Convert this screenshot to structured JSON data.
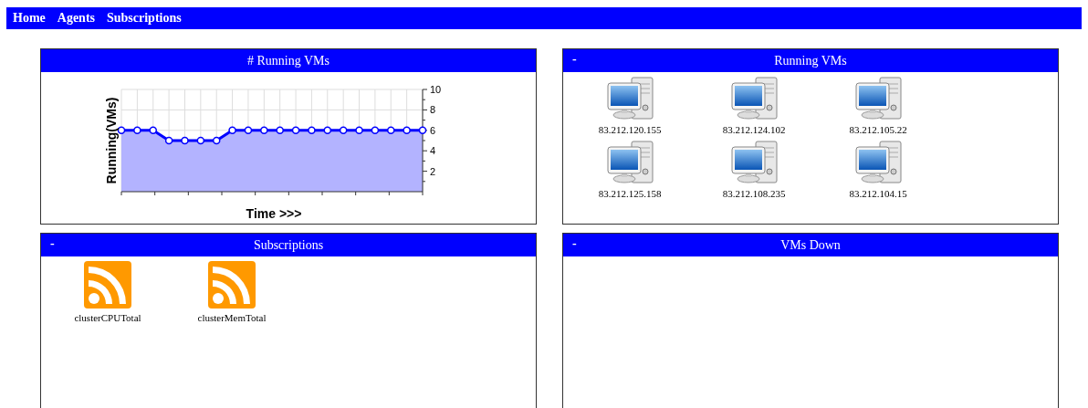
{
  "nav": [
    {
      "label": "Home"
    },
    {
      "label": "Agents"
    },
    {
      "label": "Subscriptions"
    }
  ],
  "panels": [
    {
      "kind": "chart",
      "title": "# Running VMs",
      "chart_data": {
        "type": "area",
        "xlabel": "Time >>>",
        "ylabel": "Running(VMs)",
        "values": [
          6,
          6,
          6,
          5,
          5,
          5,
          5,
          6,
          6,
          6,
          6,
          6,
          6,
          6,
          6,
          6,
          6,
          6,
          6,
          6
        ],
        "ylim": [
          0,
          10
        ],
        "yticks": [
          2,
          4,
          6,
          8,
          10
        ],
        "grid": true
      }
    },
    {
      "kind": "hosts",
      "title": "Running VMs",
      "toggle": "-",
      "items": [
        {
          "label": "83.212.120.155"
        },
        {
          "label": "83.212.124.102"
        },
        {
          "label": "83.212.105.22"
        },
        {
          "label": "83.212.125.158"
        },
        {
          "label": "83.212.108.235"
        },
        {
          "label": "83.212.104.15"
        }
      ]
    },
    {
      "kind": "feeds",
      "title": "Subscriptions",
      "toggle": "-",
      "items": [
        {
          "label": "clusterCPUTotal"
        },
        {
          "label": "clusterMemTotal"
        }
      ]
    },
    {
      "kind": "hosts",
      "title": "VMs Down",
      "toggle": "-"
    }
  ]
}
